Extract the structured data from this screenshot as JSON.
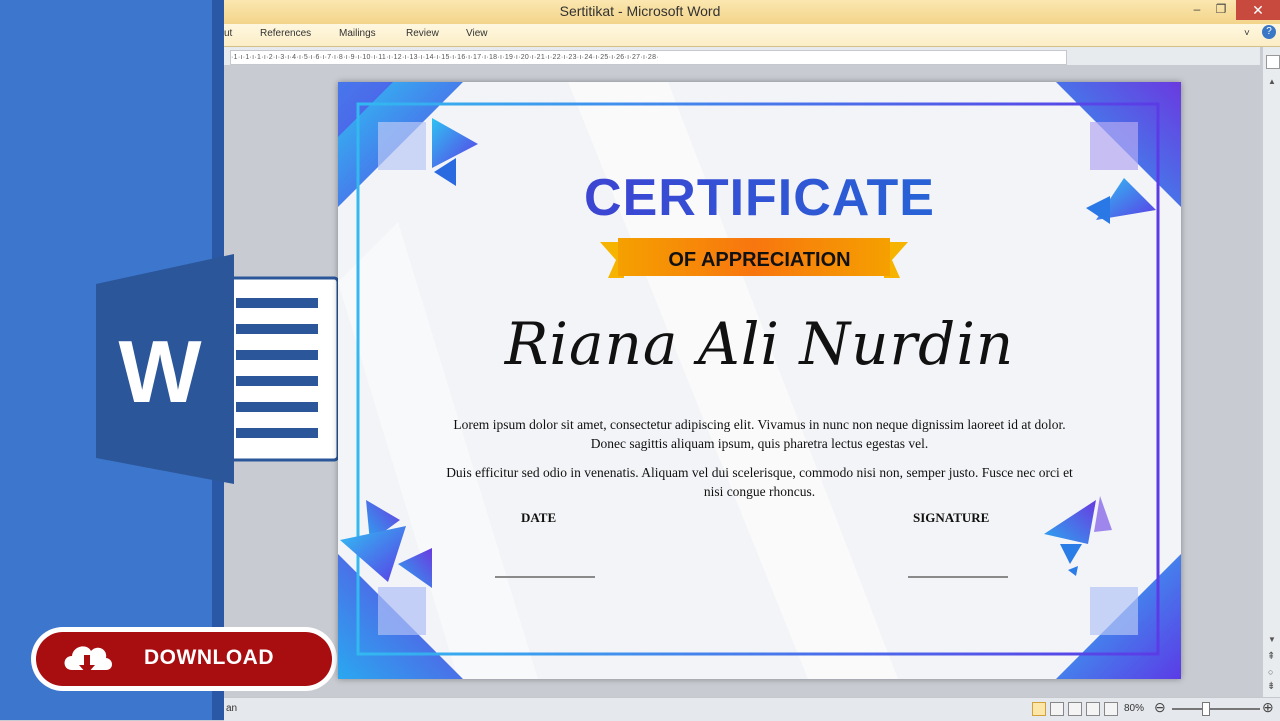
{
  "window": {
    "title": "Sertitikat  -  Microsoft Word",
    "ribbon_tabs": [
      "ut",
      "References",
      "Mailings",
      "Review",
      "View"
    ],
    "ruler_text": "·1·ı·1·ı·1·ı·2·ı·3·ı·4·ı·5·ı·6·ı·7·ı·8·ı·9·ı·10·ı·11·ı·12·ı·13·ı·14·ı·15·ı·16·ı·17·ı·18·ı·19·ı·20·ı·21·ı·22·ı·23·ı·24·ı·25·ı·26·ı·27·ı·28·",
    "status_left": "an",
    "zoom": "80%"
  },
  "promo": {
    "download_label": "DOWNLOAD",
    "word_letter": "W"
  },
  "certificate": {
    "title": "CERTIFICATE",
    "subtitle": "OF APPRECIATION",
    "recipient": "Riana Ali Nurdin",
    "paragraph1": "Lorem ipsum dolor sit amet, consectetur adipiscing elit. Vivamus in nunc non neque dignissim laoreet id at dolor. Donec sagittis aliquam ipsum, quis pharetra lectus egestas vel.",
    "paragraph2": "Duis efficitur sed odio in venenatis. Aliquam vel dui scelerisque, commodo nisi non, semper justo. Fusce nec orci et nisi congue rhoncus.",
    "date_label": "DATE",
    "signature_label": "SIGNATURE"
  },
  "colors": {
    "accent_blue": "#2a3ec6",
    "ribbon_orange": "#f78a0e",
    "download_red": "#a80d10",
    "word_blue": "#3d77cd"
  },
  "icons": [
    "minimize-icon",
    "restore-icon",
    "close-icon",
    "help-icon",
    "cloud-download-icon",
    "word-logo-icon"
  ]
}
